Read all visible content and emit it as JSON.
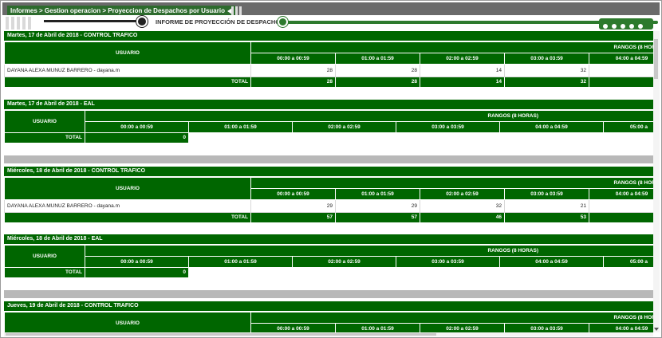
{
  "breadcrumb": "Informes > Gestion operacion > Proyeccion de Despachos por Usuario",
  "report_title": "INFORME DE PROYECCIÓN DE DESPACHOS",
  "labels": {
    "usuario": "USUARIO",
    "rangos": "RANGOS (8 HORAS)",
    "total": "TOTAL"
  },
  "ranges": [
    "00:00 a 00:59",
    "01:00 a 01:59",
    "02:00 a 02:59",
    "03:00 a 03:59",
    "04:00 a 04:59",
    "05:00 a"
  ],
  "sections": [
    {
      "title": "Martes, 17 de Abril de 2018 - CONTROL TRAFICO",
      "user": "DAYANA ALEXA MUNUZ BARRERO - dayana.m",
      "values": [
        "28",
        "28",
        "14",
        "32",
        ""
      ],
      "totals": [
        "28",
        "28",
        "14",
        "32",
        ""
      ]
    },
    {
      "title": "Martes, 17 de Abril de 2018 - EAL",
      "total": "0"
    },
    {
      "title": "Miércoles, 18 de Abril de 2018 - CONTROL TRAFICO",
      "user": "DAYANA ALEXA MUNUZ BARRERO - dayana.m",
      "values": [
        "29",
        "29",
        "32",
        "21",
        ""
      ],
      "totals": [
        "57",
        "57",
        "46",
        "53",
        ""
      ]
    },
    {
      "title": "Miércoles, 18 de Abril de 2018 - EAL",
      "total": "0"
    },
    {
      "title": "Jueves, 19 de Abril de 2018 - CONTROL TRAFICO"
    }
  ]
}
